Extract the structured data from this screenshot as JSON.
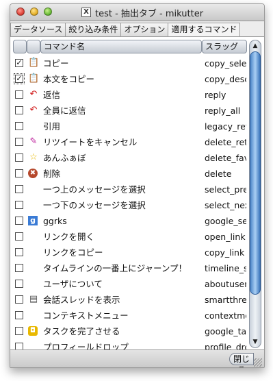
{
  "window": {
    "title": "test - 抽出タブ - mikutter",
    "app_icon_glyph": "X"
  },
  "tabs": [
    "データソース",
    "絞り込み条件",
    "オプション",
    "適用するコマンド"
  ],
  "active_tab_index": 3,
  "table": {
    "headers": {
      "command_name": "コマンド名",
      "slug": "スラッグ"
    },
    "rows": [
      {
        "checked": true,
        "icon": "copy-icon",
        "glyph": "📋",
        "name": "コピー",
        "slug": "copy_selected"
      },
      {
        "checked": true,
        "icon": "copy-body-icon",
        "glyph": "📋",
        "name": "本文をコピー",
        "slug": "copy_description"
      },
      {
        "checked": false,
        "icon": "reply-icon",
        "glyph": "↶",
        "name": "返信",
        "slug": "reply"
      },
      {
        "checked": false,
        "icon": "reply-all-icon",
        "glyph": "↶",
        "name": "全員に返信",
        "slug": "reply_all"
      },
      {
        "checked": false,
        "icon": "",
        "glyph": "",
        "name": "引用",
        "slug": "legacy_retweet"
      },
      {
        "checked": false,
        "icon": "cancel-retweet-icon",
        "glyph": "✎",
        "name": "リツイートをキャンセル",
        "slug": "delete_retweet"
      },
      {
        "checked": false,
        "icon": "star-icon",
        "glyph": "☆",
        "name": "あんふぁぼ",
        "slug": "delete_favorite"
      },
      {
        "checked": false,
        "icon": "delete-icon",
        "glyph": "✖",
        "name": "削除",
        "slug": "delete"
      },
      {
        "checked": false,
        "icon": "",
        "glyph": "",
        "name": "一つ上のメッセージを選択",
        "slug": "select_prev"
      },
      {
        "checked": false,
        "icon": "",
        "glyph": "",
        "name": "一つ下のメッセージを選択",
        "slug": "select_next"
      },
      {
        "checked": false,
        "icon": "google-icon",
        "glyph": "g",
        "name": "ggrks",
        "slug": "google_search"
      },
      {
        "checked": false,
        "icon": "",
        "glyph": "",
        "name": "リンクを開く",
        "slug": "open_link"
      },
      {
        "checked": false,
        "icon": "",
        "glyph": "",
        "name": "リンクをコピー",
        "slug": "copy_link"
      },
      {
        "checked": false,
        "icon": "",
        "glyph": "",
        "name": "タイムラインの一番上にジャーンプ！",
        "slug": "timeline_scroll_to_top"
      },
      {
        "checked": false,
        "icon": "",
        "glyph": "",
        "name": "ユーザについて",
        "slug": "aboutuser"
      },
      {
        "checked": false,
        "icon": "thread-icon",
        "glyph": "▤",
        "name": "会話スレッドを表示",
        "slug": "smartthread"
      },
      {
        "checked": false,
        "icon": "",
        "glyph": "",
        "name": "コンテキストメニュー",
        "slug": "contextmenu"
      },
      {
        "checked": false,
        "icon": "task-icon",
        "glyph": "◘",
        "name": "タスクを完了させる",
        "slug": "google_tasks"
      },
      {
        "checked": false,
        "icon": "",
        "glyph": "",
        "name": "プロフィールドロップ",
        "slug": "profile_drop"
      }
    ]
  },
  "buttons": {
    "close": "閉じる"
  },
  "colors": {
    "scroll_thumb": "#6aa3dc",
    "reply_red": "#d01818",
    "delete_brown": "#b5482c",
    "google_blue": "#3a7bd5",
    "task_yellow": "#e8b800",
    "copy_orange": "#e07a1f"
  }
}
